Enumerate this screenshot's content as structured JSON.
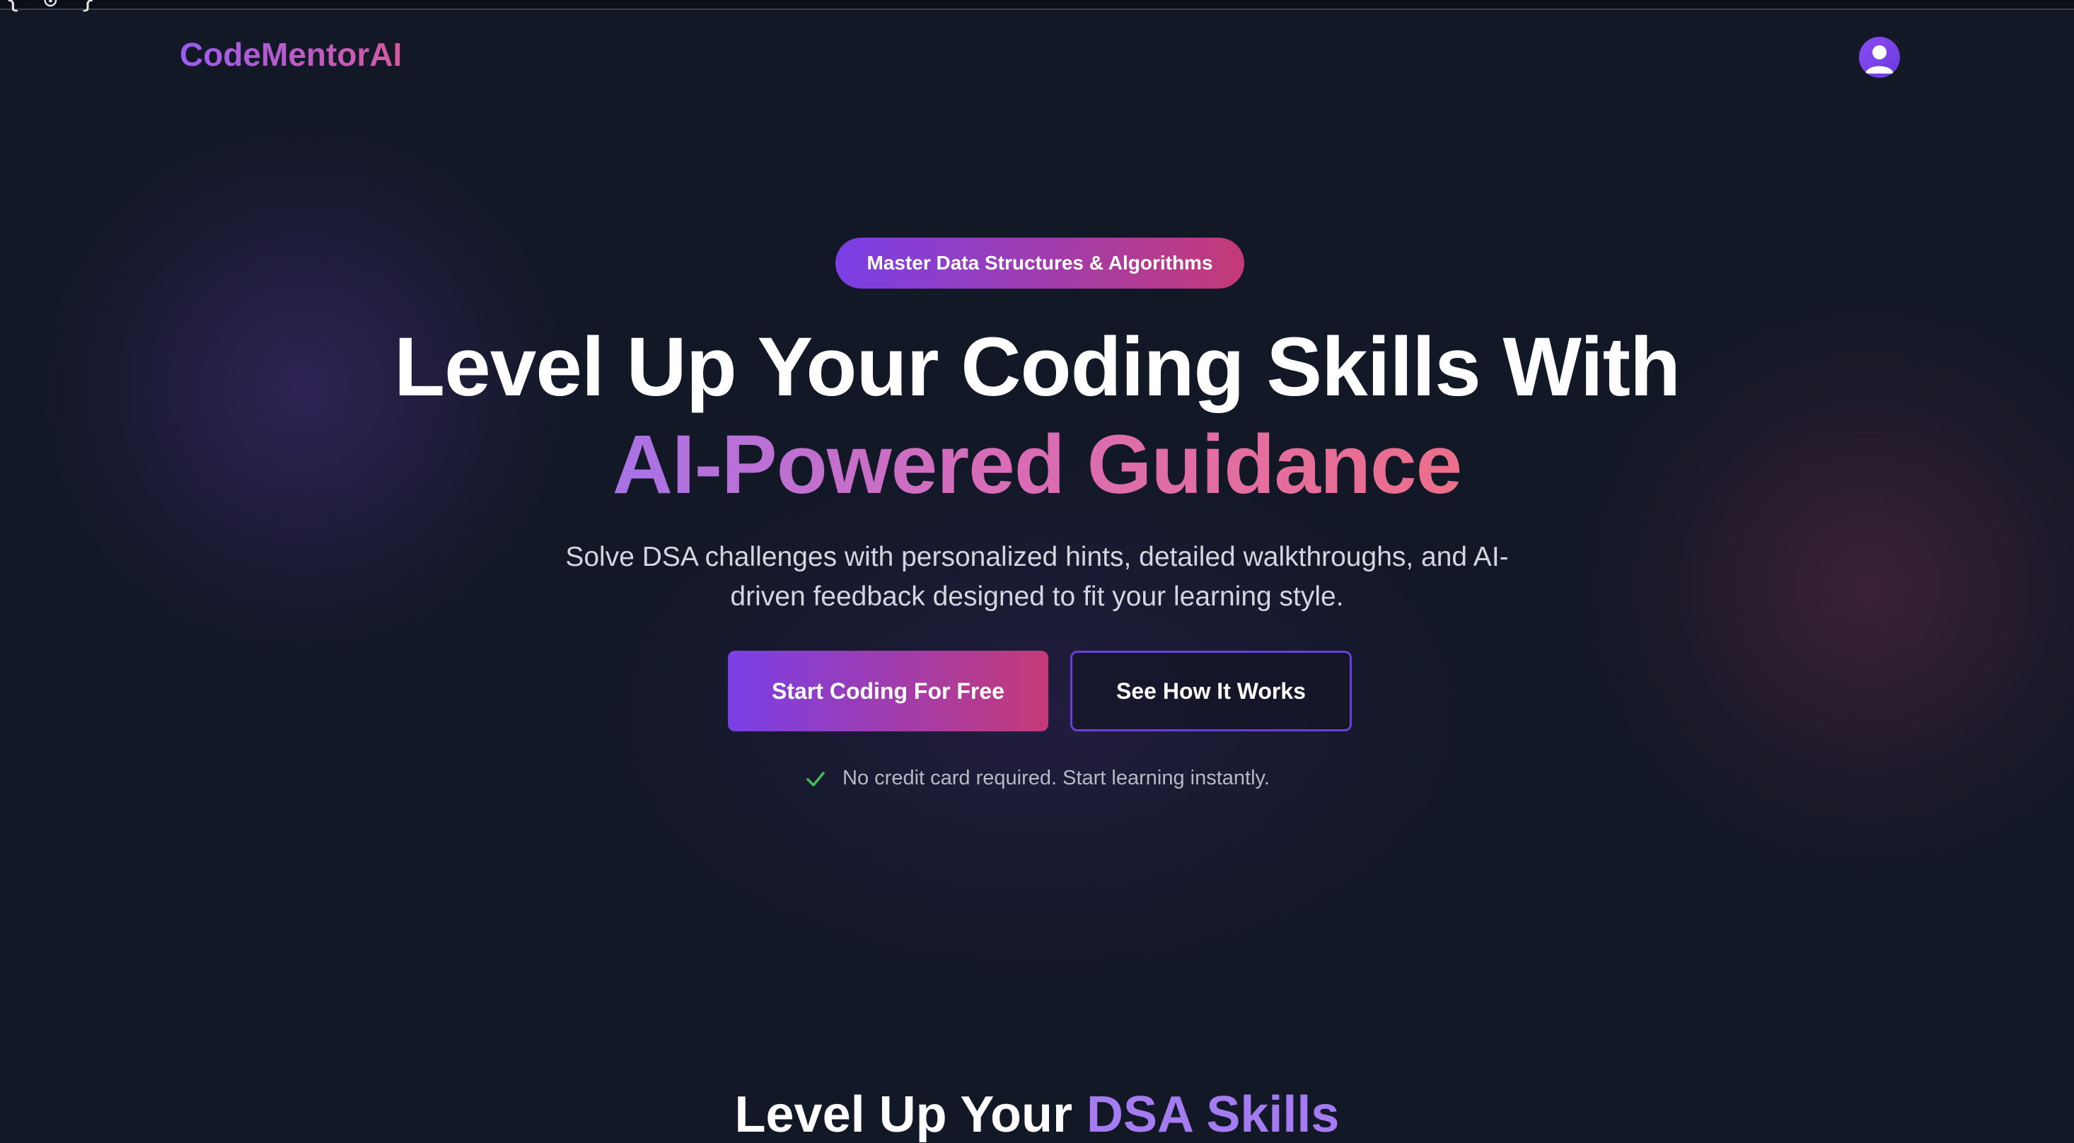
{
  "browser": {
    "edge_glyph": "{ ⊙ }"
  },
  "nav": {
    "logo": "CodeMentorAI",
    "avatar_icon": "user-icon"
  },
  "hero": {
    "badge": "Master Data Structures & Algorithms",
    "headline_line1": "Level Up Your Coding Skills With",
    "headline_line2": "AI-Powered Guidance",
    "subtitle": "Solve DSA challenges with personalized hints, detailed walkthroughs, and AI-driven feedback designed to fit your learning style.",
    "primary_cta": "Start Coding For Free",
    "secondary_cta": "See How It Works",
    "note": "No credit card required. Start learning instantly.",
    "note_icon": "check-icon"
  },
  "section": {
    "title_prefix": "Level Up Your ",
    "title_accent": "DSA Skills"
  },
  "colors": {
    "background": "#121826",
    "accent_purple": "#7a3fe6",
    "accent_pink": "#c43a78",
    "check_green": "#3fbf5a",
    "section_accent": "#a57bf2"
  }
}
